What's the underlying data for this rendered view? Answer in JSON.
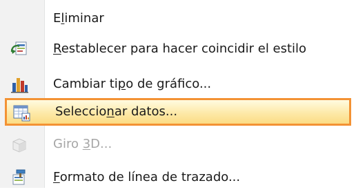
{
  "menu": {
    "items": [
      {
        "pre": "E",
        "u": "l",
        "post": "iminar",
        "icon": "none",
        "state": "normal"
      },
      {
        "pre": "",
        "u": "R",
        "post": "establecer para hacer coincidir el estilo",
        "icon": "reset-style-icon",
        "state": "normal"
      },
      {
        "pre": "Cambiar ti",
        "u": "p",
        "post": "o de gráfico...",
        "icon": "bar-chart-icon",
        "state": "normal"
      },
      {
        "pre": "Seleccio",
        "u": "n",
        "post": "ar datos...",
        "icon": "select-data-icon",
        "state": "highlighted"
      },
      {
        "pre": "Giro ",
        "u": "3",
        "post": "D...",
        "icon": "cube-3d-icon",
        "state": "disabled"
      },
      {
        "pre": "",
        "u": "F",
        "post": "ormato de línea de trazado...",
        "icon": "format-paint-icon",
        "state": "normal"
      }
    ]
  },
  "colors": {
    "highlight_border": "#f39234",
    "highlight_fill": "#fde9a8",
    "gutter": "#f2f2f2",
    "disabled_text": "#a6a6a6"
  }
}
